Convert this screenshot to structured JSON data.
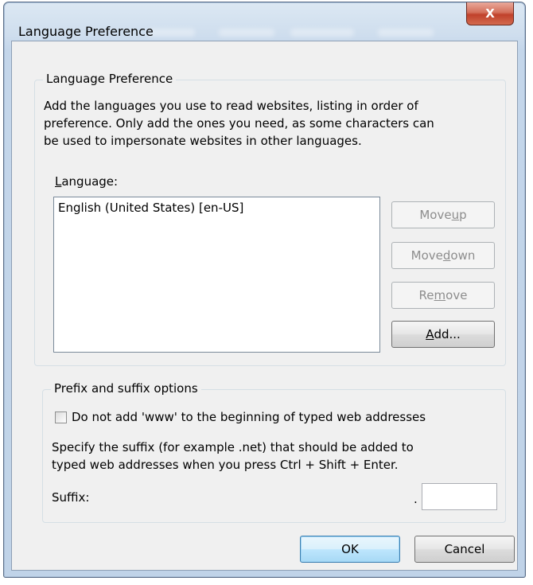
{
  "window": {
    "title": "Language Preference",
    "close_glyph": "X"
  },
  "language_group": {
    "legend": "Language Preference",
    "description_lines": [
      "Add the languages you use to read websites, listing in order of",
      "preference. Only add the ones you need, as some characters can",
      "be used to impersonate websites in other languages."
    ],
    "list_label_prefix": "",
    "list_label_access": "L",
    "list_label_rest": "anguage:",
    "items": [
      "English (United States) [en-US]"
    ],
    "buttons": {
      "move_up_pre": "Move ",
      "move_up_acc": "u",
      "move_up_post": "p",
      "move_down_pre": "Move ",
      "move_down_acc": "d",
      "move_down_post": "own",
      "remove_pre": "Re",
      "remove_acc": "m",
      "remove_post": "ove",
      "add_pre": "",
      "add_acc": "A",
      "add_post": "dd..."
    }
  },
  "prefix_group": {
    "legend": "Prefix and suffix options",
    "checkbox_label": "Do not add 'www' to the beginning of typed web addresses",
    "checkbox_checked": false,
    "suffix_description_lines": [
      "Specify the suffix (for example .net) that should be added to",
      "typed web addresses when you press Ctrl + Shift + Enter."
    ],
    "suffix_label": "Suffix:",
    "suffix_dot": ".",
    "suffix_value": ""
  },
  "dialog_buttons": {
    "ok": "OK",
    "cancel": "Cancel"
  }
}
